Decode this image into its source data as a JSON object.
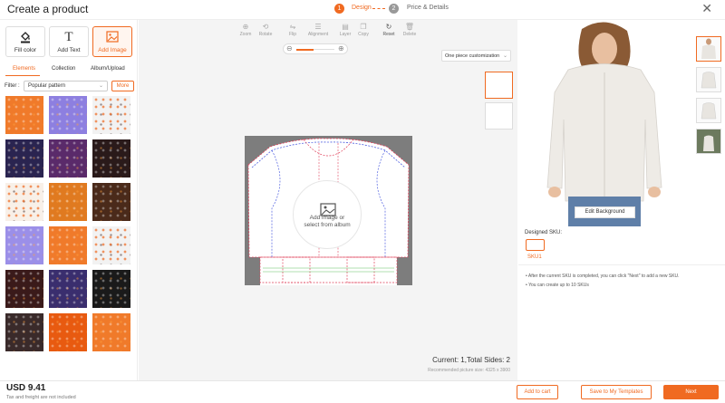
{
  "header": {
    "title": "Create a product",
    "steps": [
      {
        "num": "1",
        "label": "Design"
      },
      {
        "num": "2",
        "label": "Price & Details"
      }
    ],
    "close_icon": "close-icon"
  },
  "tools": [
    {
      "label": "Fill color",
      "icon": "paint-bucket-icon"
    },
    {
      "label": "Add Text",
      "icon": "text-icon"
    },
    {
      "label": "Add Image",
      "icon": "image-icon"
    }
  ],
  "tabs": [
    "Elements",
    "Collection",
    "Album/Upload"
  ],
  "filter": {
    "label": "Filter :",
    "value": "Popular pattern",
    "more": "More"
  },
  "canvas_tools": [
    "Zoom",
    "Rotate",
    "Flip",
    "Alignment",
    "Layer",
    "Copy",
    "Reset",
    "Delete"
  ],
  "zoom_level": 0.45,
  "piece_select": "One piece customization",
  "add_image_text": {
    "line1": "Add image or",
    "line2": "select from album"
  },
  "current_sides": "Current: 1,Total Sides: 2",
  "recommended_size": "Recommended picture size: 4325 x 3900",
  "preview": {
    "edit_background": "Edit Background"
  },
  "sku": {
    "designed_label": "Designed SKU:",
    "sku_label": "SKU1",
    "notes": [
      "After the current SKU is completed, you can click \"Next\" to add a new SKU.",
      "You can create up to 10 SKUs"
    ]
  },
  "footer": {
    "price": "USD 9.41",
    "tax_note": "Tax and freight are not included",
    "add_to_cart": "Add to cart",
    "save_templates": "Save to My Templates",
    "next": "Next"
  },
  "colors": {
    "accent": "#f06a21",
    "patterns": [
      "#f07a2a",
      "#8d7fe0",
      "#f2f2f2",
      "#2a2450",
      "#5a2a6a",
      "#2a1a1a",
      "#f8f0e8",
      "#e07a20",
      "#4a2a1a",
      "#9b8fe8",
      "#f07a2a",
      "#f2f2f2",
      "#3a1a1a",
      "#3a2e6e",
      "#1a1a1a",
      "#3a2a2a",
      "#e85a10",
      "#f07a2a"
    ]
  }
}
